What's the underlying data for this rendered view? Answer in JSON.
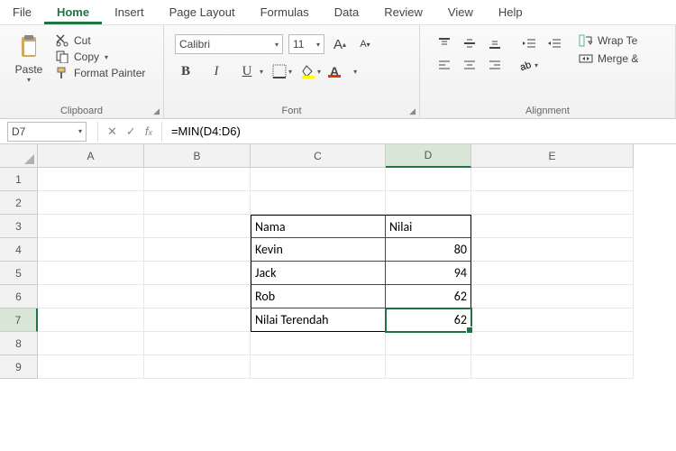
{
  "menu": {
    "file": "File",
    "home": "Home",
    "insert": "Insert",
    "page_layout": "Page Layout",
    "formulas": "Formulas",
    "data": "Data",
    "review": "Review",
    "view": "View",
    "help": "Help"
  },
  "clipboard": {
    "paste": "Paste",
    "cut": "Cut",
    "copy": "Copy",
    "fmt": "Format Painter",
    "label": "Clipboard"
  },
  "font": {
    "name": "Calibri",
    "size": "11",
    "label": "Font"
  },
  "align": {
    "label": "Alignment",
    "wrap": "Wrap Te",
    "merge": "Merge &"
  },
  "fbar": {
    "ref": "D7",
    "formula": "=MIN(D4:D6)"
  },
  "cols": [
    "A",
    "B",
    "C",
    "D",
    "E"
  ],
  "rows": [
    "1",
    "2",
    "3",
    "4",
    "5",
    "6",
    "7",
    "8",
    "9"
  ],
  "cells": {
    "C3": "Nama",
    "D3": "Nilai",
    "C4": "Kevin",
    "D4": "80",
    "C5": "Jack",
    "D5": "94",
    "C6": "Rob",
    "D6": "62",
    "C7": "Nilai Terendah",
    "D7": "62"
  },
  "chart_data": {
    "type": "table",
    "title": "",
    "columns": [
      "Nama",
      "Nilai"
    ],
    "rows": [
      [
        "Kevin",
        80
      ],
      [
        "Jack",
        94
      ],
      [
        "Rob",
        62
      ]
    ],
    "summary": {
      "label": "Nilai Terendah",
      "value": 62,
      "formula": "=MIN(D4:D6)"
    }
  }
}
